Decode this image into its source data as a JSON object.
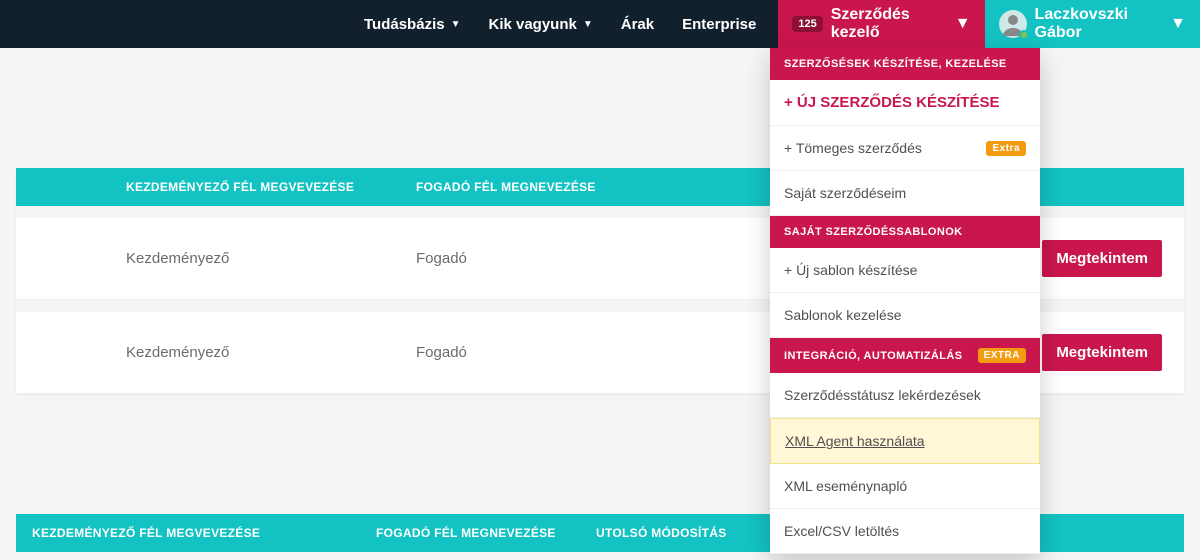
{
  "nav": {
    "items": [
      {
        "label": "Tudásbázis",
        "dropdown": true
      },
      {
        "label": "Kik vagyunk",
        "dropdown": true
      },
      {
        "label": "Árak",
        "dropdown": false
      },
      {
        "label": "Enterprise",
        "dropdown": false
      }
    ],
    "contract_manager": {
      "badge": "125",
      "label": "Szerződés kezelő"
    },
    "user": {
      "name": "Laczkovszki Gábor"
    }
  },
  "table1": {
    "headers": {
      "c1": "KEZDEMÉNYEZŐ FÉL MEGVEVEZÉSE",
      "c2": "FOGADÓ FÉL MEGNEVEZÉSE"
    },
    "rows": [
      {
        "initiator": "Kezdeményező",
        "receiver": "Fogadó",
        "action": "Megtekintem"
      },
      {
        "initiator": "Kezdeményező",
        "receiver": "Fogadó",
        "action": "Megtekintem"
      }
    ]
  },
  "table2": {
    "headers": {
      "c1": "KEZDEMÉNYEZŐ FÉL MEGVEVEZÉSE",
      "c2": "FOGADÓ FÉL MEGNEVEZÉSE",
      "c3": "UTOLSÓ MÓDOSÍTÁS"
    }
  },
  "dropdown": {
    "sections": [
      {
        "header": "SZERZŐSÉSEK KÉSZÍTÉSE, KEZELÉSE",
        "items": [
          {
            "label": "+ ÚJ SZERZŐDÉS KÉSZÍTÉSE",
            "primary": true
          },
          {
            "label": "+ Tömeges szerződés",
            "extra": "Extra"
          },
          {
            "label": "Saját szerződéseim"
          }
        ]
      },
      {
        "header": "SAJÁT SZERZŐDÉSSABLONOK",
        "items": [
          {
            "label": "+ Új sablon készítése"
          },
          {
            "label": "Sablonok kezelése"
          }
        ]
      },
      {
        "header": "INTEGRÁCIÓ, AUTOMATIZÁLÁS",
        "header_badge": "EXTRA",
        "items": [
          {
            "label": "Szerződésstátusz lekérdezések"
          },
          {
            "label": "XML Agent használata",
            "highlight": true
          },
          {
            "label": "XML eseménynapló"
          },
          {
            "label": "Excel/CSV letöltés"
          }
        ]
      }
    ]
  }
}
